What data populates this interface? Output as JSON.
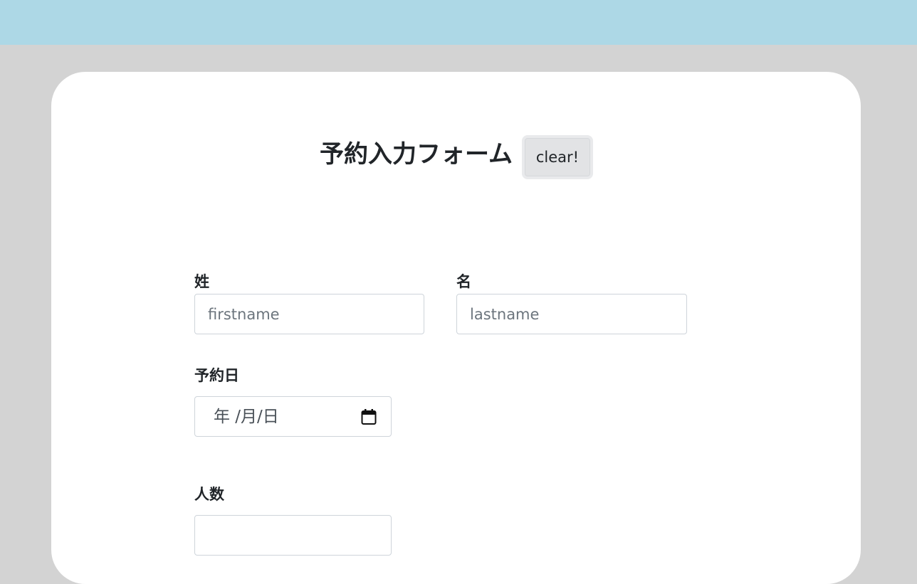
{
  "form": {
    "title": "予約入力フォーム",
    "clear_button": "clear!",
    "lastname_label": "姓",
    "lastname_placeholder": "firstname",
    "firstname_label": "名",
    "firstname_placeholder": "lastname",
    "date_label": "予約日",
    "date_placeholder": "年 /月/日",
    "date_icon": "calendar-icon",
    "people_label": "人数",
    "people_value": ""
  },
  "colors": {
    "topbar": "#add8e6",
    "background": "#d3d3d3",
    "card": "#ffffff"
  }
}
